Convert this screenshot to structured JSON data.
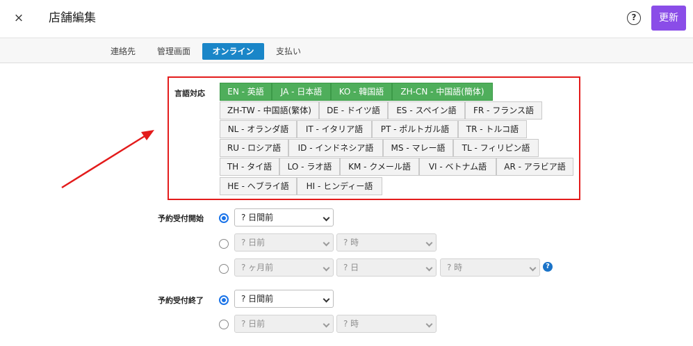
{
  "header": {
    "close_label": "×",
    "title": "店舗編集",
    "help_label": "?",
    "update_label": "更新"
  },
  "tabs": [
    {
      "label": "連絡先",
      "active": false
    },
    {
      "label": "管理画面",
      "active": false
    },
    {
      "label": "オンライン",
      "active": true
    },
    {
      "label": "支払い",
      "active": false
    }
  ],
  "languages": {
    "label": "言語対応",
    "items": [
      {
        "label": "EN - 英語",
        "selected": true
      },
      {
        "label": "JA - 日本語",
        "selected": true
      },
      {
        "label": "KO - 韓国語",
        "selected": true
      },
      {
        "label": "ZH-CN - 中国語(簡体)",
        "selected": true
      },
      {
        "label": "ZH-TW - 中国語(繁体)",
        "selected": false
      },
      {
        "label": "DE - ドイツ語",
        "selected": false
      },
      {
        "label": "ES - スペイン語",
        "selected": false
      },
      {
        "label": "FR - フランス語",
        "selected": false
      },
      {
        "label": "NL - オランダ語",
        "selected": false
      },
      {
        "label": "IT - イタリア語",
        "selected": false
      },
      {
        "label": "PT - ポルトガル語",
        "selected": false
      },
      {
        "label": "TR - トルコ語",
        "selected": false
      },
      {
        "label": "RU - ロシア語",
        "selected": false
      },
      {
        "label": "ID - インドネシア語",
        "selected": false
      },
      {
        "label": "MS - マレー語",
        "selected": false
      },
      {
        "label": "TL - フィリピン語",
        "selected": false
      },
      {
        "label": "TH - タイ語",
        "selected": false
      },
      {
        "label": "LO - ラオ語",
        "selected": false
      },
      {
        "label": "KM - クメール語",
        "selected": false
      },
      {
        "label": "VI - ベトナム語",
        "selected": false
      },
      {
        "label": "AR - アラビア語",
        "selected": false
      },
      {
        "label": "HE - ヘブライ語",
        "selected": false
      },
      {
        "label": "HI - ヒンディー語",
        "selected": false
      }
    ]
  },
  "reservation_start": {
    "label": "予約受付開始",
    "option1": {
      "selected": true,
      "days_before": "? 日間前"
    },
    "option2": {
      "selected": false,
      "days": "? 日前",
      "hour": "? 時"
    },
    "option3": {
      "selected": false,
      "months": "? ヶ月前",
      "day": "? 日",
      "hour": "? 時"
    },
    "help_label": "?"
  },
  "reservation_end": {
    "label": "予約受付終了",
    "option1": {
      "selected": true,
      "days_before": "? 日間前"
    },
    "option2": {
      "selected": false,
      "days": "? 日前",
      "hour": "? 時"
    }
  },
  "colors": {
    "accent": "#8a4de8",
    "tab_active": "#1a86c8",
    "lang_selected": "#4fae5b",
    "annotation": "#e31b1b",
    "radio": "#1a73e8"
  }
}
